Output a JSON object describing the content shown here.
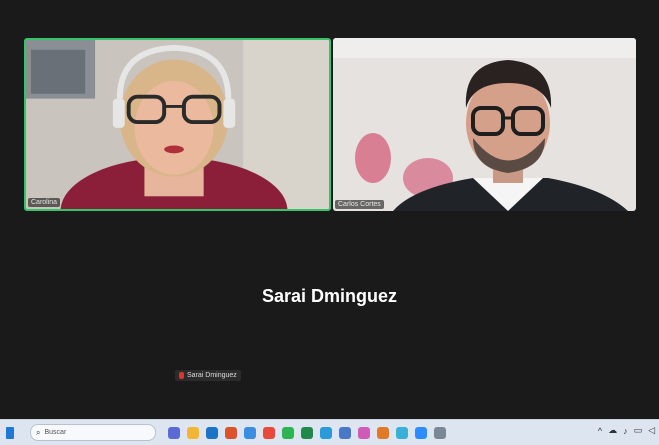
{
  "participants": [
    {
      "name": "Carolina",
      "active_speaker": true
    },
    {
      "name": "Carlos Cortes",
      "active_speaker": false
    }
  ],
  "main_participant": {
    "name": "Sarai Dminguez",
    "label": "Sarai Dminguez"
  },
  "taskbar": {
    "search_placeholder": "Buscar",
    "apps": [
      {
        "icon": "teams-icon",
        "color": "#5b6bd6"
      },
      {
        "icon": "file-explorer-icon",
        "color": "#f2b632"
      },
      {
        "icon": "mail-icon",
        "color": "#1c74c8"
      },
      {
        "icon": "office-icon",
        "color": "#d9532f"
      },
      {
        "icon": "photos-icon",
        "color": "#3a8de0"
      },
      {
        "icon": "chrome-icon",
        "color": "#e8493a"
      },
      {
        "icon": "whatsapp-icon",
        "color": "#2fb452"
      },
      {
        "icon": "excel-icon",
        "color": "#1f8a4a"
      },
      {
        "icon": "edge-icon",
        "color": "#2a9ad8"
      },
      {
        "icon": "store-icon",
        "color": "#4a78c8"
      },
      {
        "icon": "copilot-icon",
        "color": "#d05ab8"
      },
      {
        "icon": "paint-icon",
        "color": "#e07a2a"
      },
      {
        "icon": "chat-icon",
        "color": "#3ab0d8"
      },
      {
        "icon": "zoom-icon",
        "color": "#2d8cff"
      },
      {
        "icon": "settings-icon",
        "color": "#7a8896"
      }
    ],
    "tray_icons": [
      "chevron-up-icon",
      "cloud-icon",
      "mic-icon",
      "network-icon",
      "speaker-icon"
    ]
  }
}
